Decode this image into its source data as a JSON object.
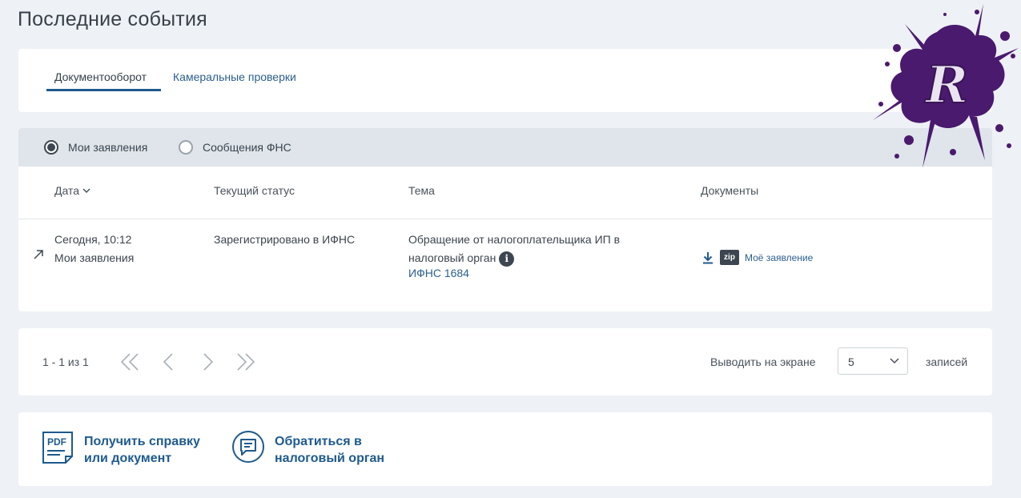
{
  "page": {
    "title": "Последние события"
  },
  "tabs": [
    {
      "label": "Документооборот",
      "active": true
    },
    {
      "label": "Камеральные проверки",
      "active": false
    }
  ],
  "filter": {
    "options": [
      {
        "label": "Мои заявления",
        "selected": true
      },
      {
        "label": "Сообщения ФНС",
        "selected": false
      }
    ]
  },
  "table": {
    "columns": [
      "Дата",
      "Текущий статус",
      "Тема",
      "Документы"
    ],
    "rows": [
      {
        "date": "Сегодня, 10:12",
        "source": "Мои заявления",
        "status": "Зарегистрировано в ИФНС",
        "topic": "Обращение от налогоплательщика ИП в налоговый орган",
        "inspection": "ИФНС 1684",
        "document": {
          "format": "zip",
          "label": "Моё заявление"
        }
      }
    ]
  },
  "pagination": {
    "range": "1 - 1 из 1",
    "per_page_label": "Выводить на экране",
    "per_page_value": "5",
    "records_label": "записей"
  },
  "actions": {
    "certificate": {
      "icon_text": "PDF",
      "line1": "Получить справку",
      "line2": "или документ"
    },
    "appeal": {
      "line1": "Обратиться в",
      "line2": "налоговый орган"
    }
  },
  "watermark": {
    "letter": "R"
  },
  "colors": {
    "accent": "#1e5a8d",
    "link": "#2b5e8e",
    "background": "#eef1f5",
    "filter_bar": "#dfe5ea",
    "splash": "#4a1a6e"
  }
}
